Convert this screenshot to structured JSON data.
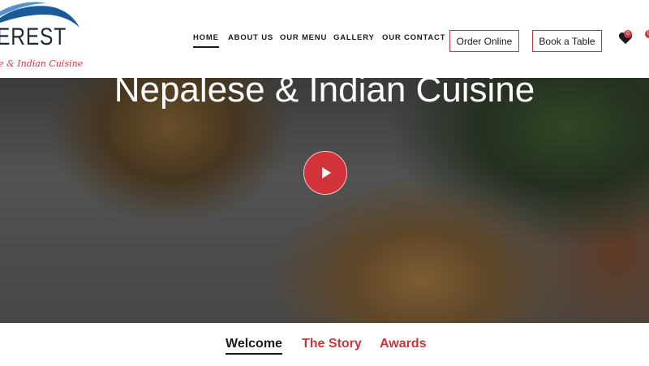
{
  "logo": {
    "name": "ERESТ",
    "tagline": "e & Indian Cuisine"
  },
  "nav": {
    "items": [
      {
        "label": "HOME",
        "active": true
      },
      {
        "label": "ABOUT US"
      },
      {
        "label": "OUR MENU"
      },
      {
        "label": "GALLERY"
      },
      {
        "label": "OUR CONTACT"
      }
    ]
  },
  "buttons": {
    "order_online": "Order Online",
    "book_table": "Book a Table"
  },
  "wishlist": {
    "icon": "heart-icon",
    "count": "0"
  },
  "cart": {
    "count": "0"
  },
  "hero": {
    "title": "Nepalese & Indian Cuisine",
    "play_icon": "play-icon"
  },
  "tabs": [
    {
      "label": "Welcome",
      "active": true
    },
    {
      "label": "The Story"
    },
    {
      "label": "Awards"
    }
  ],
  "colors": {
    "accent": "#c8353b",
    "text": "#1a1a1a",
    "logo_blue": "#1b5a9a"
  }
}
